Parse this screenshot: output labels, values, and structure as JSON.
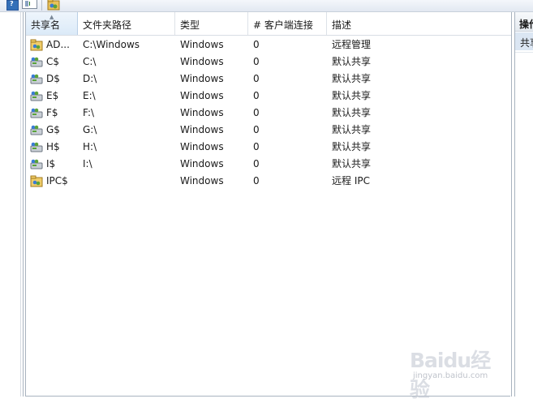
{
  "toolbar": {
    "icons": [
      "help-icon",
      "show-hide-pane-icon",
      "shared-folder-icon"
    ]
  },
  "columns": [
    {
      "key": "name",
      "label": "共享名",
      "sorted": true
    },
    {
      "key": "path",
      "label": "文件夹路径"
    },
    {
      "key": "type",
      "label": "类型"
    },
    {
      "key": "count",
      "label": "# 客户端连接"
    },
    {
      "key": "desc",
      "label": "描述"
    }
  ],
  "rows": [
    {
      "icon": "admin-share-icon",
      "name": "AD...",
      "path": "C:\\Windows",
      "type": "Windows",
      "count": "0",
      "desc": "远程管理"
    },
    {
      "icon": "drive-share-icon",
      "name": "C$",
      "path": "C:\\",
      "type": "Windows",
      "count": "0",
      "desc": "默认共享"
    },
    {
      "icon": "drive-share-icon",
      "name": "D$",
      "path": "D:\\",
      "type": "Windows",
      "count": "0",
      "desc": "默认共享"
    },
    {
      "icon": "drive-share-icon",
      "name": "E$",
      "path": "E:\\",
      "type": "Windows",
      "count": "0",
      "desc": "默认共享"
    },
    {
      "icon": "drive-share-icon",
      "name": "F$",
      "path": "F:\\",
      "type": "Windows",
      "count": "0",
      "desc": "默认共享"
    },
    {
      "icon": "drive-share-icon",
      "name": "G$",
      "path": "G:\\",
      "type": "Windows",
      "count": "0",
      "desc": "默认共享"
    },
    {
      "icon": "drive-share-icon",
      "name": "H$",
      "path": "H:\\",
      "type": "Windows",
      "count": "0",
      "desc": "默认共享"
    },
    {
      "icon": "drive-share-icon",
      "name": "I$",
      "path": "I:\\",
      "type": "Windows",
      "count": "0",
      "desc": "默认共享"
    },
    {
      "icon": "ipc-share-icon",
      "name": "IPC$",
      "path": "",
      "type": "Windows",
      "count": "0",
      "desc": "远程 IPC"
    }
  ],
  "actions": {
    "title": "操作",
    "item": "共享"
  },
  "watermark": {
    "logo": "Baidu经验",
    "sub": "jingyan.baidu.com"
  }
}
